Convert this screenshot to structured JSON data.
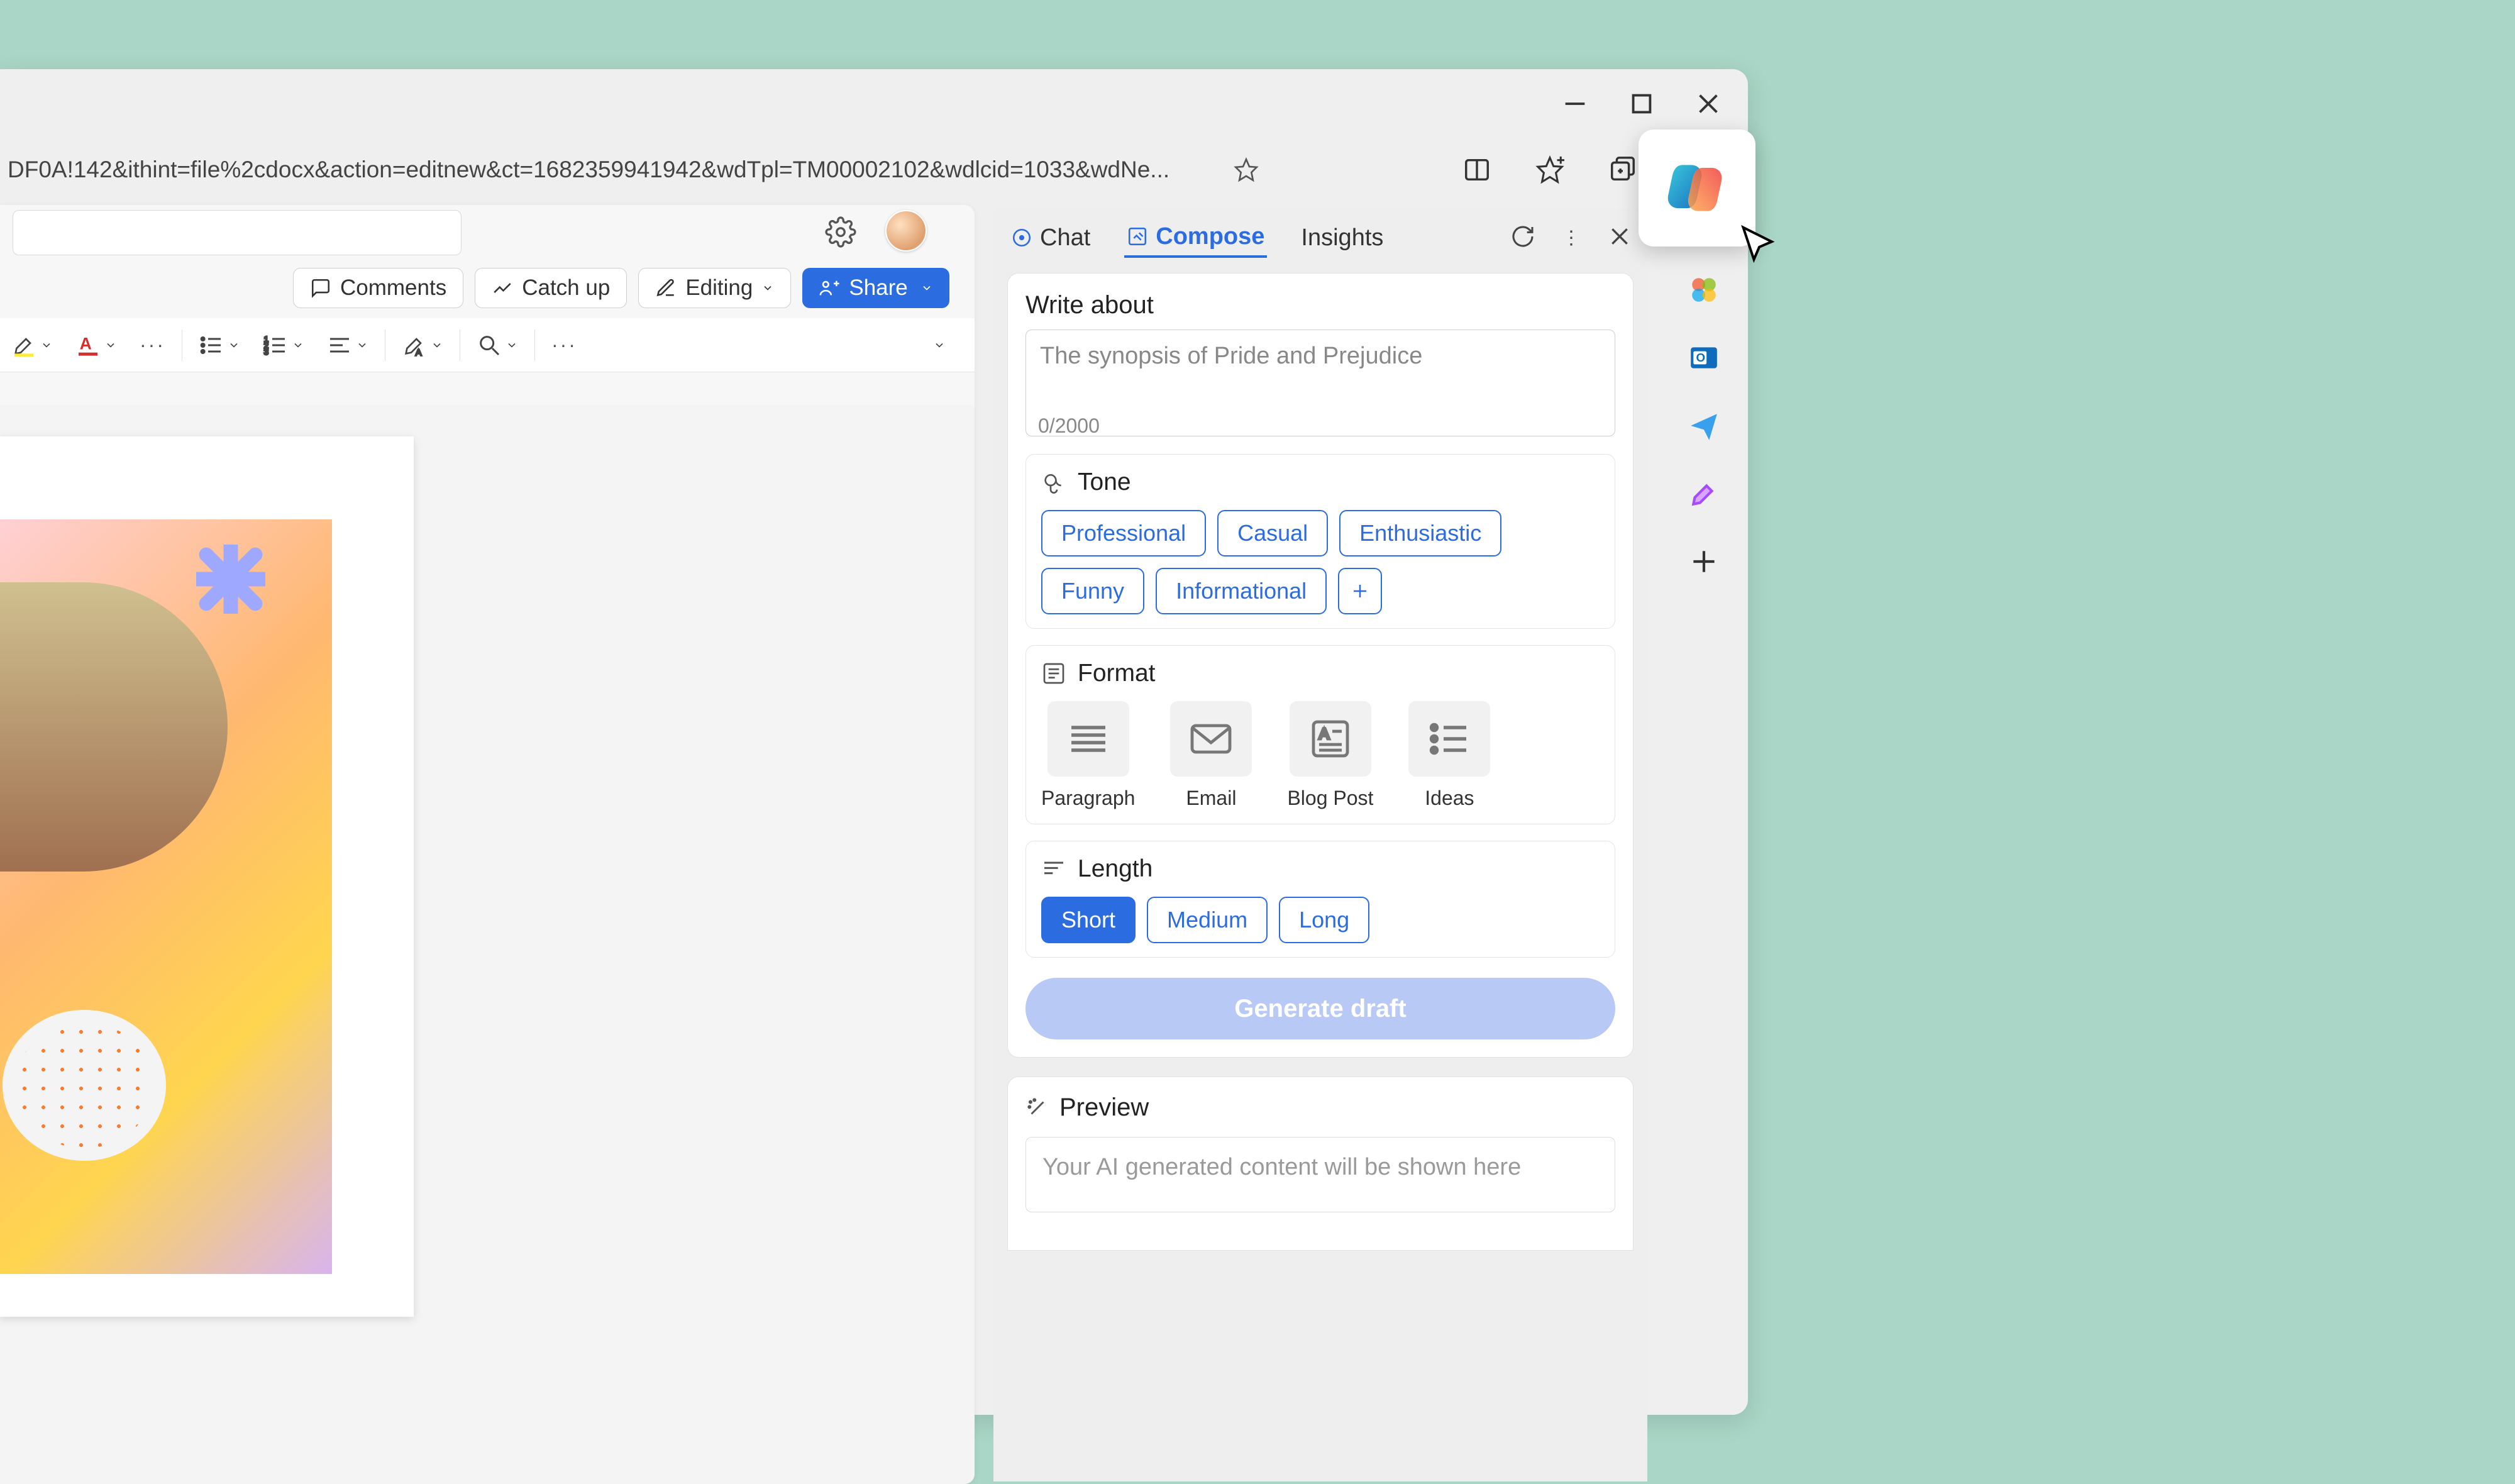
{
  "browser": {
    "url_fragment": "DF0A!142&ithint=file%2cdocx&action=editnew&ct=1682359941942&wdTpl=TM00002102&wdlcid=1033&wdNe..."
  },
  "word": {
    "actions": {
      "comments": "Comments",
      "catch_up": "Catch up",
      "editing": "Editing",
      "share": "Share"
    }
  },
  "sidebar": {
    "tabs": {
      "chat": "Chat",
      "compose": "Compose",
      "insights": "Insights"
    },
    "write_about_label": "Write about",
    "write_about_placeholder": "The synopsis of Pride and Prejudice",
    "counter": "0/2000",
    "tone_label": "Tone",
    "tone_options": {
      "professional": "Professional",
      "casual": "Casual",
      "enthusiastic": "Enthusiastic",
      "funny": "Funny",
      "informational": "Informational"
    },
    "format_label": "Format",
    "format_options": {
      "paragraph": "Paragraph",
      "email": "Email",
      "blog": "Blog Post",
      "ideas": "Ideas"
    },
    "length_label": "Length",
    "length_options": {
      "short": "Short",
      "medium": "Medium",
      "long": "Long"
    },
    "generate_label": "Generate draft",
    "preview_label": "Preview",
    "preview_placeholder": "Your AI generated content will be shown here"
  }
}
